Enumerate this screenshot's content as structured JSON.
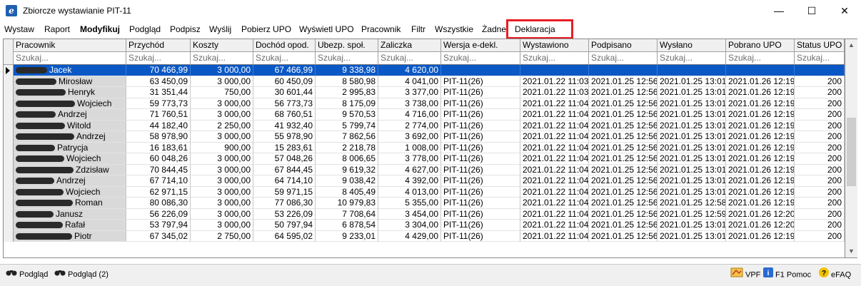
{
  "window": {
    "title": "Zbiorcze wystawianie PIT-11"
  },
  "menu": [
    {
      "label": "Wystaw",
      "bold": false
    },
    {
      "label": "Raport",
      "bold": false
    },
    {
      "label": "Modyfikuj",
      "bold": true
    },
    {
      "label": "Podgląd",
      "bold": false
    },
    {
      "label": "Podpisz",
      "bold": false
    },
    {
      "label": "Wyślij",
      "bold": false
    },
    {
      "label": "Pobierz UPO",
      "bold": false
    },
    {
      "label": "Wyświetl UPO",
      "bold": false
    },
    {
      "label": "Pracownik",
      "bold": false
    },
    {
      "label": "Filtr",
      "bold": false
    },
    {
      "label": "Wszystkie",
      "bold": false
    },
    {
      "label": "Żadne",
      "bold": false
    },
    {
      "label": "Deklaracja",
      "bold": false
    }
  ],
  "highlight_color": "#e81e25",
  "selection_color": "#0a58c6",
  "grid": {
    "filter_placeholder": "Szukaj...",
    "columns": [
      "Pracownik",
      "Przychód",
      "Koszty",
      "Dochód opod.",
      "Ubezp. społ.",
      "Zaliczka",
      "Wersja e-dekl.",
      "Wystawiono",
      "Podpisano",
      "Wysłano",
      "Pobrano UPO",
      "Status UPO"
    ],
    "rows": [
      {
        "name": "Jacek",
        "przychod": "70 466,99",
        "koszty": "3 000,00",
        "dochod": "67 466,99",
        "ubezp": "9 338,98",
        "zaliczka": "4 620,00",
        "wersja": "",
        "wystawiono": "",
        "podpisano": "",
        "wyslano": "",
        "pobrano": "",
        "status": "",
        "selected": true
      },
      {
        "name": "Mirosław",
        "przychod": "63 450,09",
        "koszty": "3 000,00",
        "dochod": "60 450,09",
        "ubezp": "8 580,98",
        "zaliczka": "4 041,00",
        "wersja": "PIT-11(26)",
        "wystawiono": "2021.01.22 11:03",
        "podpisano": "2021.01.25 12:56",
        "wyslano": "2021.01.25 13:01",
        "pobrano": "2021.01.26 12:19",
        "status": "200"
      },
      {
        "name": "Henryk",
        "przychod": "31 351,44",
        "koszty": "750,00",
        "dochod": "30 601,44",
        "ubezp": "2 995,83",
        "zaliczka": "3 377,00",
        "wersja": "PIT-11(26)",
        "wystawiono": "2021.01.22 11:03",
        "podpisano": "2021.01.25 12:56",
        "wyslano": "2021.01.25 13:01",
        "pobrano": "2021.01.26 12:19",
        "status": "200"
      },
      {
        "name": "Wojciech",
        "przychod": "59 773,73",
        "koszty": "3 000,00",
        "dochod": "56 773,73",
        "ubezp": "8 175,09",
        "zaliczka": "3 738,00",
        "wersja": "PIT-11(26)",
        "wystawiono": "2021.01.22 11:04",
        "podpisano": "2021.01.25 12:56",
        "wyslano": "2021.01.25 13:01",
        "pobrano": "2021.01.26 12:19",
        "status": "200"
      },
      {
        "name": "Andrzej",
        "przychod": "71 760,51",
        "koszty": "3 000,00",
        "dochod": "68 760,51",
        "ubezp": "9 570,53",
        "zaliczka": "4 716,00",
        "wersja": "PIT-11(26)",
        "wystawiono": "2021.01.22 11:04",
        "podpisano": "2021.01.25 12:56",
        "wyslano": "2021.01.25 13:01",
        "pobrano": "2021.01.26 12:19",
        "status": "200"
      },
      {
        "name": "Witold",
        "przychod": "44 182,40",
        "koszty": "2 250,00",
        "dochod": "41 932,40",
        "ubezp": "5 799,74",
        "zaliczka": "2 774,00",
        "wersja": "PIT-11(26)",
        "wystawiono": "2021.01.22 11:04",
        "podpisano": "2021.01.25 12:56",
        "wyslano": "2021.01.25 13:01",
        "pobrano": "2021.01.26 12:19",
        "status": "200"
      },
      {
        "name": "Andrzej",
        "przychod": "58 978,90",
        "koszty": "3 000,00",
        "dochod": "55 978,90",
        "ubezp": "7 862,56",
        "zaliczka": "3 692,00",
        "wersja": "PIT-11(26)",
        "wystawiono": "2021.01.22 11:04",
        "podpisano": "2021.01.25 12:56",
        "wyslano": "2021.01.25 13:01",
        "pobrano": "2021.01.26 12:19",
        "status": "200"
      },
      {
        "name": "Patrycja",
        "przychod": "16 183,61",
        "koszty": "900,00",
        "dochod": "15 283,61",
        "ubezp": "2 218,78",
        "zaliczka": "1 008,00",
        "wersja": "PIT-11(26)",
        "wystawiono": "2021.01.22 11:04",
        "podpisano": "2021.01.25 12:56",
        "wyslano": "2021.01.25 13:01",
        "pobrano": "2021.01.26 12:19",
        "status": "200"
      },
      {
        "name": "Wojciech",
        "przychod": "60 048,26",
        "koszty": "3 000,00",
        "dochod": "57 048,26",
        "ubezp": "8 006,65",
        "zaliczka": "3 778,00",
        "wersja": "PIT-11(26)",
        "wystawiono": "2021.01.22 11:04",
        "podpisano": "2021.01.25 12:56",
        "wyslano": "2021.01.25 13:01",
        "pobrano": "2021.01.26 12:19",
        "status": "200"
      },
      {
        "name": "Zdzisław",
        "przychod": "70 844,45",
        "koszty": "3 000,00",
        "dochod": "67 844,45",
        "ubezp": "9 619,32",
        "zaliczka": "4 627,00",
        "wersja": "PIT-11(26)",
        "wystawiono": "2021.01.22 11:04",
        "podpisano": "2021.01.25 12:56",
        "wyslano": "2021.01.25 13:01",
        "pobrano": "2021.01.26 12:19",
        "status": "200"
      },
      {
        "name": "Andrzej",
        "przychod": "67 714,10",
        "koszty": "3 000,00",
        "dochod": "64 714,10",
        "ubezp": "9 038,42",
        "zaliczka": "4 392,00",
        "wersja": "PIT-11(26)",
        "wystawiono": "2021.01.22 11:04",
        "podpisano": "2021.01.25 12:56",
        "wyslano": "2021.01.25 13:01",
        "pobrano": "2021.01.26 12:19",
        "status": "200"
      },
      {
        "name": "Wojciech",
        "przychod": "62 971,15",
        "koszty": "3 000,00",
        "dochod": "59 971,15",
        "ubezp": "8 405,49",
        "zaliczka": "4 013,00",
        "wersja": "PIT-11(26)",
        "wystawiono": "2021.01.22 11:04",
        "podpisano": "2021.01.25 12:56",
        "wyslano": "2021.01.25 13:01",
        "pobrano": "2021.01.26 12:19",
        "status": "200"
      },
      {
        "name": "Roman",
        "przychod": "80 086,30",
        "koszty": "3 000,00",
        "dochod": "77 086,30",
        "ubezp": "10 979,83",
        "zaliczka": "5 355,00",
        "wersja": "PIT-11(26)",
        "wystawiono": "2021.01.22 11:04",
        "podpisano": "2021.01.25 12:56",
        "wyslano": "2021.01.25 12:58",
        "pobrano": "2021.01.26 12:19",
        "status": "200"
      },
      {
        "name": "Janusz",
        "przychod": "56 226,09",
        "koszty": "3 000,00",
        "dochod": "53 226,09",
        "ubezp": "7 708,64",
        "zaliczka": "3 454,00",
        "wersja": "PIT-11(26)",
        "wystawiono": "2021.01.22 11:04",
        "podpisano": "2021.01.25 12:56",
        "wyslano": "2021.01.25 12:59",
        "pobrano": "2021.01.26 12:20",
        "status": "200"
      },
      {
        "name": "Rafał",
        "przychod": "53 797,94",
        "koszty": "3 000,00",
        "dochod": "50 797,94",
        "ubezp": "6 878,54",
        "zaliczka": "3 304,00",
        "wersja": "PIT-11(26)",
        "wystawiono": "2021.01.22 11:04",
        "podpisano": "2021.01.25 12:56",
        "wyslano": "2021.01.25 13:01",
        "pobrano": "2021.01.26 12:20",
        "status": "200"
      },
      {
        "name": "Piotr",
        "przychod": "67 345,02",
        "koszty": "2 750,00",
        "dochod": "64 595,02",
        "ubezp": "9 233,01",
        "zaliczka": "4 429,00",
        "wersja": "PIT-11(26)",
        "wystawiono": "2021.01.22 11:04",
        "podpisano": "2021.01.25 12:56",
        "wyslano": "2021.01.25 13:01",
        "pobrano": "2021.01.26 12:19",
        "status": "200"
      }
    ]
  },
  "statusbar": {
    "left_buttons": [
      {
        "label": "Podgląd",
        "icon": "binoculars-icon"
      },
      {
        "label": "Podgląd (2)",
        "icon": "binoculars-icon"
      }
    ],
    "right_buttons": [
      {
        "label": "VPF",
        "icon": "vpf-icon"
      },
      {
        "label": "F1 Pomoc",
        "icon": "info-icon"
      },
      {
        "label": "eFAQ",
        "icon": "question-icon"
      }
    ]
  }
}
